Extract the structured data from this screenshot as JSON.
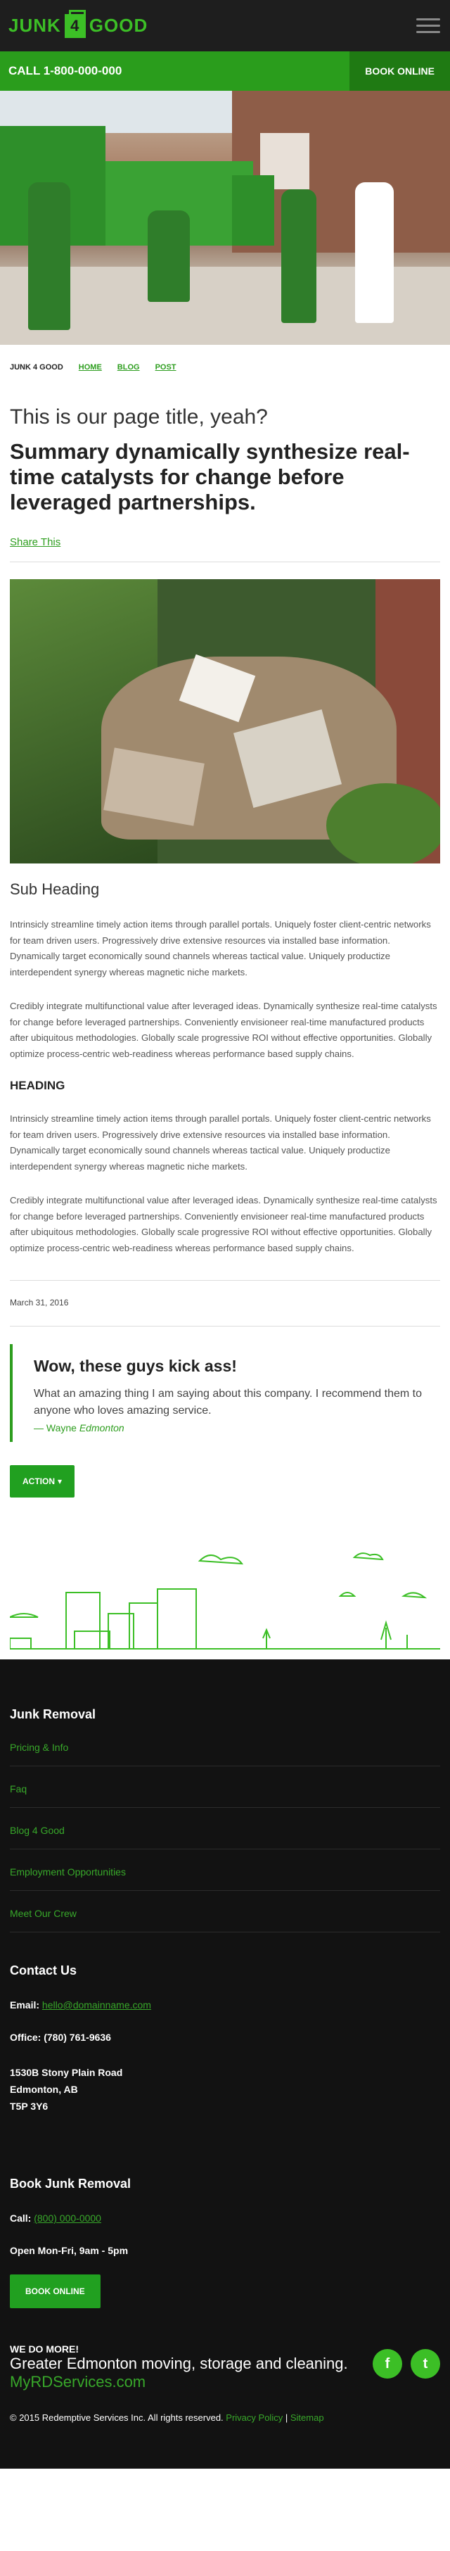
{
  "header": {
    "logo_left": "JUNK",
    "logo_middle": "4",
    "logo_right": "GOOD",
    "menu_icon": "hamburger-icon"
  },
  "callbar": {
    "call_text": "CALL 1-800-000-000",
    "book_label": "BOOK ONLINE"
  },
  "breadcrumb": {
    "current": "JUNK 4 GOOD",
    "links": [
      "HOME",
      "BLOG",
      "POST"
    ]
  },
  "post": {
    "title": "This is our page title, yeah?",
    "summary": "Summary dynamically synthesize real-time catalysts for change before leveraged partnerships.",
    "share_label": "Share This",
    "sub_heading": "Sub Heading",
    "para1": "Intrinsicly streamline timely action items through parallel portals. Uniquely foster client-centric networks for team driven users. Progressively drive extensive resources via installed base information. Dynamically target economically sound channels whereas tactical value. Uniquely productize interdependent synergy whereas magnetic niche markets.",
    "para2": "Credibly integrate multifunctional value after leveraged ideas. Dynamically synthesize real-time catalysts for change before leveraged partnerships. Conveniently envisioneer real-time manufactured products after ubiquitous methodologies. Globally scale progressive ROI without effective opportunities. Globally optimize process-centric web-readiness whereas performance based supply chains.",
    "heading": "HEADING",
    "para3": "Intrinsicly streamline timely action items through parallel portals. Uniquely foster client-centric networks for team driven users. Progressively drive extensive resources via installed base information. Dynamically target economically sound channels whereas tactical value. Uniquely productize interdependent synergy whereas magnetic niche markets.",
    "para4": "Credibly integrate multifunctional value after leveraged ideas. Dynamically synthesize real-time catalysts for change before leveraged partnerships. Conveniently envisioneer real-time manufactured products after ubiquitous methodologies. Globally scale progressive ROI without effective opportunities. Globally optimize process-centric web-readiness whereas performance based supply chains.",
    "date": "March 31, 2016"
  },
  "testimonial": {
    "title": "Wow, these guys kick ass!",
    "text": "What an amazing thing I am saying about this company. I recommend them to anyone who loves amazing service.",
    "author_prefix": "— Wayne",
    "author_last": "Edmonton"
  },
  "action_button": {
    "label": "ACTION",
    "caret": "▾"
  },
  "footer": {
    "section_title": "Junk Removal",
    "links": [
      "Pricing & Info",
      "Faq",
      "Blog 4 Good",
      "Employment Opportunities",
      "Meet Our Crew"
    ],
    "contact_title": "Contact Us",
    "email_label": "Email:",
    "email": "hello@domainname.com",
    "office": "Office: (780) 761-9636",
    "address_line1": "1530B Stony Plain Road",
    "address_line2": "Edmonton, AB",
    "address_line3": "T5P 3Y6",
    "book_title": "Book Junk Removal",
    "call_label": "Call:",
    "call_number": "(800) 000-0000",
    "hours": "Open Mon-Fri, 9am - 5pm",
    "book_button": "BOOK ONLINE",
    "we_do_more": "WE DO MORE!",
    "greater": "Greater Edmonton moving, storage and cleaning.",
    "site_link": "MyRDServices.com",
    "facebook_glyph": "f",
    "twitter_glyph": "t",
    "copyright": "© 2015 Redemptive Services Inc. All rights reserved.",
    "privacy": "Privacy Policy",
    "divider": "|",
    "sitemap": "Sitemap"
  },
  "colors": {
    "brand_green": "#2e9e1f",
    "dark_bg": "#1e1e1e",
    "footer_bg": "#121212"
  }
}
